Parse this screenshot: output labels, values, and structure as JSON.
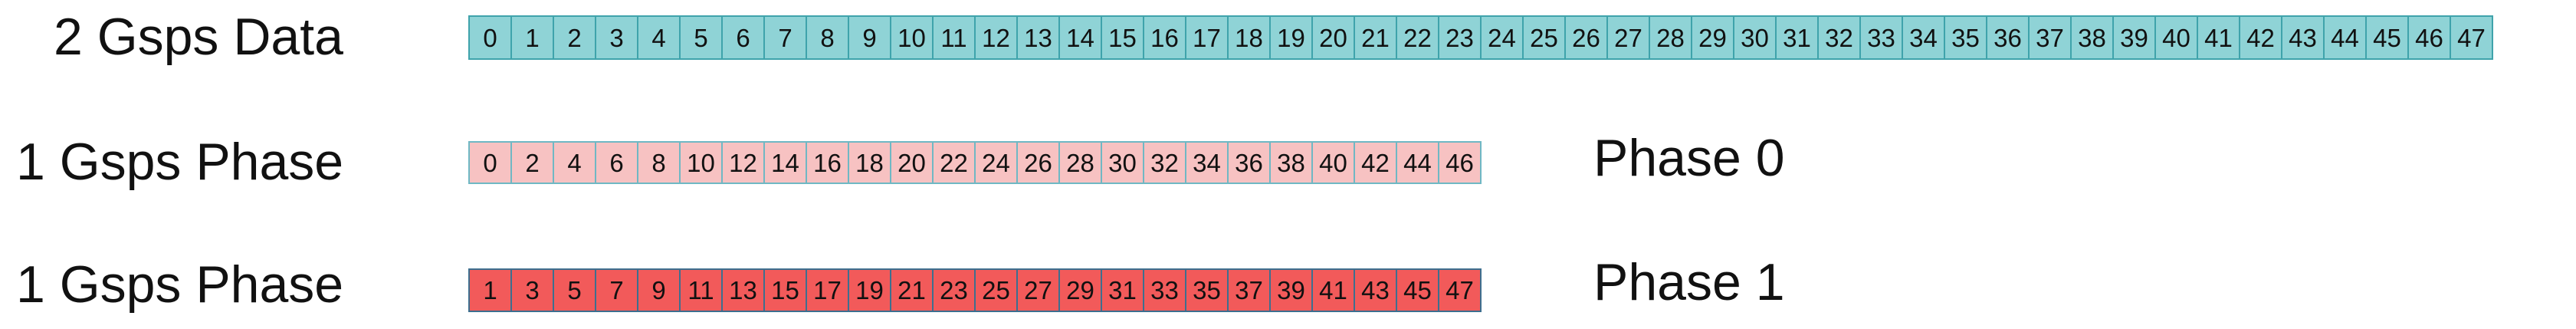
{
  "rows": [
    {
      "label": "2 Gsps Data",
      "cells": [
        "0",
        "1",
        "2",
        "3",
        "4",
        "5",
        "6",
        "7",
        "8",
        "9",
        "10",
        "11",
        "12",
        "13",
        "14",
        "15",
        "16",
        "17",
        "18",
        "19",
        "20",
        "21",
        "22",
        "23",
        "24",
        "25",
        "26",
        "27",
        "28",
        "29",
        "30",
        "31",
        "32",
        "33",
        "34",
        "35",
        "36",
        "37",
        "38",
        "39",
        "40",
        "41",
        "42",
        "43",
        "44",
        "45",
        "46",
        "47"
      ]
    },
    {
      "label": "1 Gsps Phase",
      "phase": "Phase 0",
      "cells": [
        "0",
        "2",
        "4",
        "6",
        "8",
        "10",
        "12",
        "14",
        "16",
        "18",
        "20",
        "22",
        "24",
        "26",
        "28",
        "30",
        "32",
        "34",
        "36",
        "38",
        "40",
        "42",
        "44",
        "46"
      ]
    },
    {
      "label": "1 Gsps Phase",
      "phase": "Phase 1",
      "cells": [
        "1",
        "3",
        "5",
        "7",
        "9",
        "11",
        "13",
        "15",
        "17",
        "19",
        "21",
        "23",
        "25",
        "27",
        "29",
        "31",
        "33",
        "35",
        "37",
        "39",
        "41",
        "43",
        "45",
        "47"
      ]
    }
  ],
  "colors": {
    "data_fill": "#8fd3d6",
    "data_border": "#3fa3ab",
    "phase0_fill": "#f7c2c2",
    "phase0_border": "#6fb8c4",
    "phase1_fill": "#f25a5a",
    "phase1_border": "#3d6f8f"
  }
}
